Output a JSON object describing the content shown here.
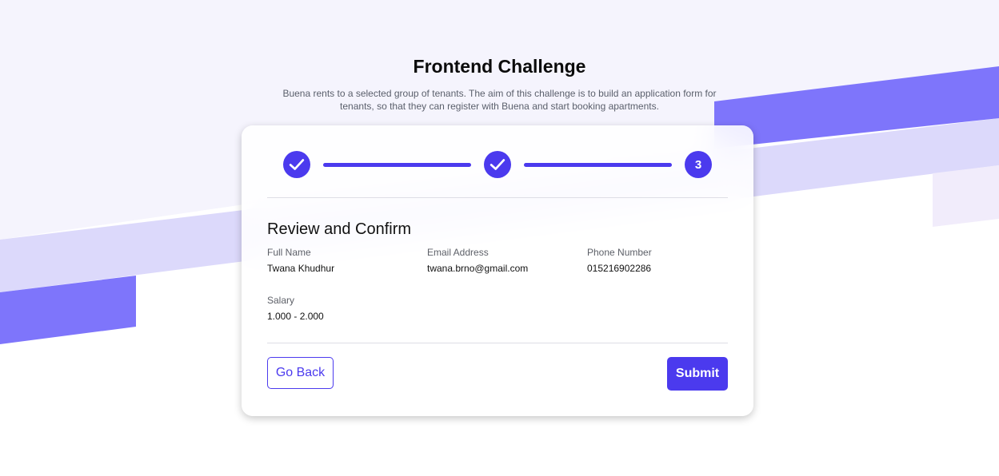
{
  "header": {
    "title": "Frontend Challenge",
    "subtitle": "Buena rents to a selected group of tenants. The aim of this challenge is to build an application form for tenants, so that they can register with Buena and start booking apartments."
  },
  "stepper": {
    "steps": [
      {
        "state": "completed",
        "icon": "checkmark-icon"
      },
      {
        "state": "completed",
        "icon": "checkmark-icon"
      },
      {
        "state": "active",
        "label": "3"
      }
    ]
  },
  "review": {
    "title": "Review and Confirm",
    "fields": {
      "full_name": {
        "label": "Full Name",
        "value": "Twana Khudhur"
      },
      "email": {
        "label": "Email Address",
        "value": "twana.brno@gmail.com"
      },
      "phone": {
        "label": "Phone Number",
        "value": "015216902286"
      },
      "salary": {
        "label": "Salary",
        "value": "1.000 - 2.000"
      }
    }
  },
  "actions": {
    "back_label": "Go Back",
    "submit_label": "Submit"
  },
  "colors": {
    "accent": "#4b3aee",
    "background_tint": "#f5f4fd",
    "stripe_light": "#dcd9fb",
    "stripe_dark": "#7e75fb",
    "stripe_pale": "#f1ecfb"
  }
}
